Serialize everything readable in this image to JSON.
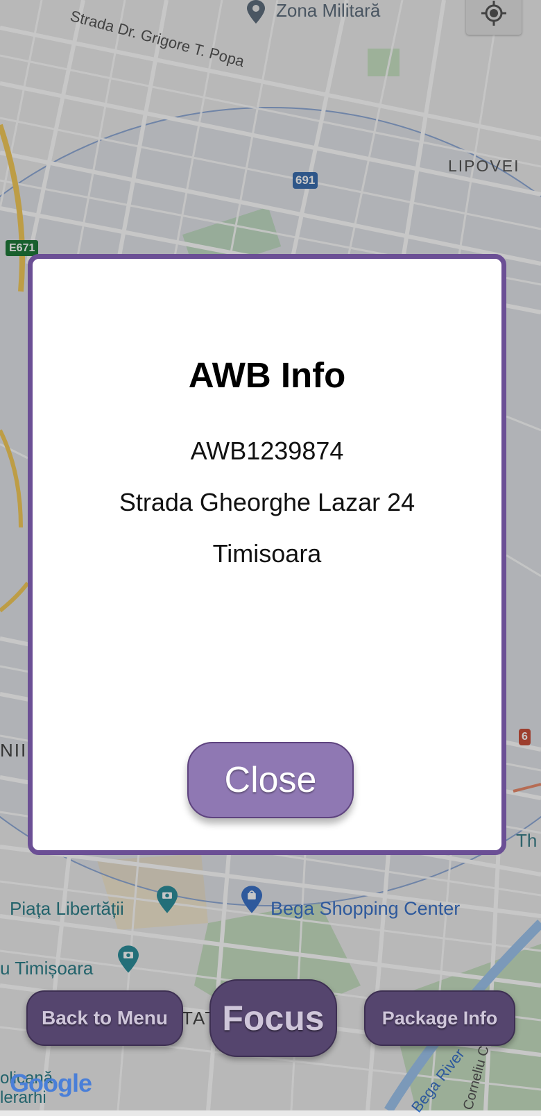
{
  "map": {
    "labels": {
      "street_top": "Strada Dr. Grigore T. Popa",
      "zona_militara": "Zona Militară",
      "lipovei": "LIPOVEI",
      "road_691": "691",
      "road_e671": "E671",
      "road_6": "6",
      "partial_left": "NII",
      "partial_right": "Th",
      "piata_libertatii": "Piața Libertății",
      "bega_shopping": "Bega Shopping Center",
      "timisoara_poi": "u Timișoara",
      "partial_tat": "TAT",
      "bottom_left_1": "olicană",
      "bottom_left_2": "lerarhi",
      "bega_river": "Bega River",
      "corneliu": "Corneliu C"
    },
    "google_logo": "Google"
  },
  "dialog": {
    "title": "AWB Info",
    "awb": "AWB1239874",
    "address": "Strada Gheorghe Lazar 24",
    "city": "Timisoara",
    "close_label": "Close"
  },
  "bottom_bar": {
    "back_label": "Back to Menu",
    "focus_label": "Focus",
    "package_label": "Package Info"
  },
  "colors": {
    "accent": "#6b4f95",
    "button_purple": "#8f78b3",
    "bottom_button": "#55456e"
  },
  "icons": {
    "locate": "my-location-icon",
    "pin": "map-pin-icon",
    "camera": "camera-pin-icon",
    "shopping": "shopping-bag-pin-icon"
  }
}
